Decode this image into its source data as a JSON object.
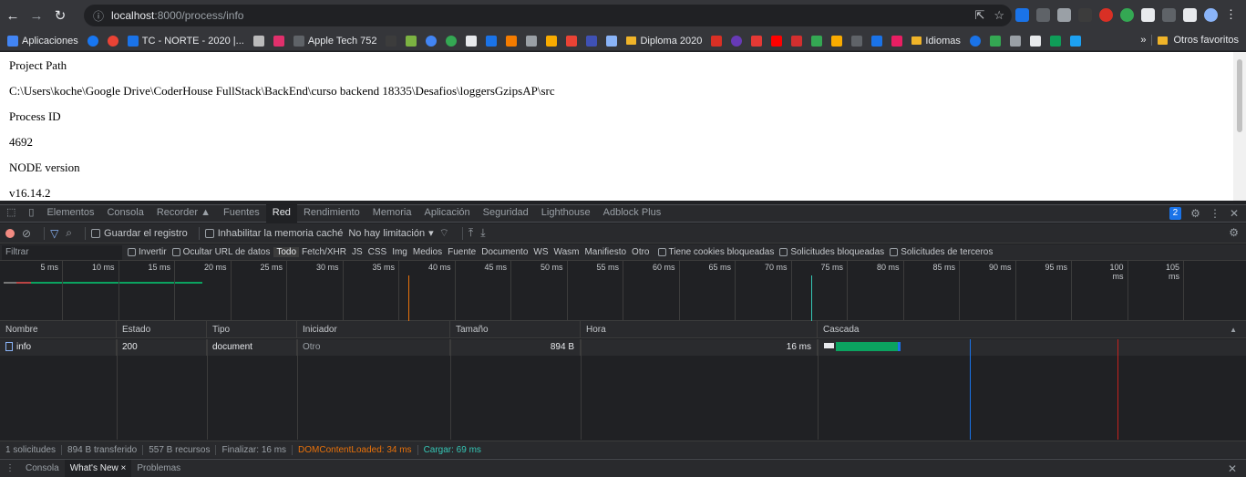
{
  "browser": {
    "url_host": "localhost",
    "url_path": ":8000/process/info",
    "bookmarks": [
      {
        "label": "Aplicaciones",
        "color": "#4285f4"
      },
      {
        "label": "",
        "color": "#1877f2",
        "round": true
      },
      {
        "label": "",
        "color": "#ea4335",
        "round": true
      },
      {
        "label": "TC - NORTE - 2020 |...",
        "color": "#1a73e8"
      },
      {
        "label": "",
        "color": "#bbbbbb"
      },
      {
        "label": "",
        "color": "#e1306c"
      },
      {
        "label": "Apple Tech 752",
        "color": "#5f6368"
      },
      {
        "label": "",
        "color": "#3c3c3c"
      },
      {
        "label": "",
        "color": "#7cb342"
      },
      {
        "label": "",
        "color": "#4285f4",
        "round": true
      },
      {
        "label": "",
        "color": "#34a853",
        "round": true
      },
      {
        "label": "",
        "color": "#e8eaed"
      },
      {
        "label": "",
        "color": "#1a73e8"
      },
      {
        "label": "",
        "color": "#f57c00"
      },
      {
        "label": "",
        "color": "#9aa0a6"
      },
      {
        "label": "",
        "color": "#f9ab00"
      },
      {
        "label": "",
        "color": "#ea4335"
      },
      {
        "label": "",
        "color": "#3f51b5"
      },
      {
        "label": "",
        "color": "#8ab4f8"
      },
      {
        "label": "Diploma 2020",
        "folder": true
      },
      {
        "label": "",
        "color": "#d93025"
      },
      {
        "label": "",
        "color": "#673ab7",
        "round": true
      },
      {
        "label": "",
        "color": "#e53935"
      },
      {
        "label": "",
        "color": "#ff0000"
      },
      {
        "label": "",
        "color": "#d32f2f"
      },
      {
        "label": "",
        "color": "#34a853"
      },
      {
        "label": "",
        "color": "#f9ab00"
      },
      {
        "label": "",
        "color": "#5f6368"
      },
      {
        "label": "",
        "color": "#1a73e8"
      },
      {
        "label": "",
        "color": "#e91e63"
      },
      {
        "label": "Idiomas",
        "folder": true
      },
      {
        "label": "",
        "color": "#1a73e8",
        "round": true
      },
      {
        "label": "",
        "color": "#34a853"
      },
      {
        "label": "",
        "color": "#9aa0a6"
      },
      {
        "label": "",
        "color": "#e8eaed"
      },
      {
        "label": "",
        "color": "#0f9d58"
      },
      {
        "label": "",
        "color": "#1da1f2"
      }
    ],
    "bookmarks_overflow": "»",
    "other_bookmarks": "Otros favoritos"
  },
  "page": {
    "lines": [
      "Project Path",
      "C:\\Users\\koche\\Google Drive\\CoderHouse FullStack\\BackEnd\\curso backend 18335\\Desafios\\loggersGzipsAP\\src",
      "Process ID",
      "4692",
      "NODE version",
      "v16.14.2"
    ]
  },
  "devtools": {
    "tabs": [
      "Elementos",
      "Consola",
      "Recorder ▲",
      "Fuentes",
      "Red",
      "Rendimiento",
      "Memoria",
      "Aplicación",
      "Seguridad",
      "Lighthouse",
      "Adblock Plus"
    ],
    "active_tab": "Red",
    "issues_badge": "2",
    "toolbar": {
      "preserve_log": "Guardar el registro",
      "disable_cache": "Inhabilitar la memoria caché",
      "throttling": "No hay limitación"
    },
    "filter": {
      "placeholder": "Filtrar",
      "invert": "Invertir",
      "hide_data_urls": "Ocultar URL de datos",
      "types": [
        "Todo",
        "Fetch/XHR",
        "JS",
        "CSS",
        "Img",
        "Medios",
        "Fuente",
        "Documento",
        "WS",
        "Wasm",
        "Manifiesto",
        "Otro"
      ],
      "selected_type": "Todo",
      "blocked_cookies": "Tiene cookies bloqueadas",
      "blocked_requests": "Solicitudes bloqueadas",
      "third_party": "Solicitudes de terceros"
    },
    "timeline_ticks": [
      "5 ms",
      "10 ms",
      "15 ms",
      "20 ms",
      "25 ms",
      "30 ms",
      "35 ms",
      "40 ms",
      "45 ms",
      "50 ms",
      "55 ms",
      "60 ms",
      "65 ms",
      "70 ms",
      "75 ms",
      "80 ms",
      "85 ms",
      "90 ms",
      "95 ms",
      "100 ms",
      "105 ms"
    ],
    "table": {
      "headers": [
        "Nombre",
        "Estado",
        "Tipo",
        "Iniciador",
        "Tamaño",
        "Hora",
        "Cascada"
      ],
      "rows": [
        {
          "name": "info",
          "status": "200",
          "type": "document",
          "initiator": "Otro",
          "size": "894 B",
          "time": "16 ms"
        }
      ]
    },
    "summary": {
      "requests": "1 solicitudes",
      "transferred": "894 B transferido",
      "resources": "557 B recursos",
      "finish": "Finalizar: 16 ms",
      "dcl": "DOMContentLoaded: 34 ms",
      "load": "Cargar: 69 ms"
    },
    "drawer": {
      "tabs": [
        "Consola",
        "What's New",
        "Problemas"
      ],
      "active": "What's New"
    }
  }
}
